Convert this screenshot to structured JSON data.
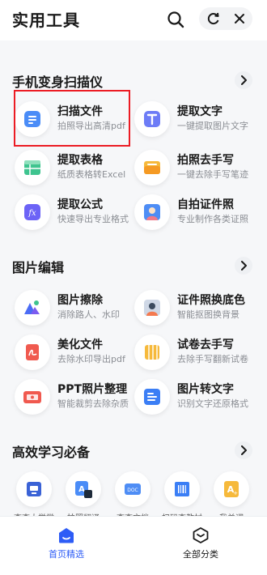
{
  "header": {
    "title": "实用工具",
    "search_icon": "search-icon",
    "capsule_left_icon": "refresh-icon",
    "capsule_right_icon": "close-icon"
  },
  "sections": [
    {
      "title": "手机变身扫描仪",
      "tools": [
        {
          "name": "扫描文件",
          "sub": "拍照导出高清pdf",
          "icon": "scan-file-icon",
          "color": "#4a8cf7"
        },
        {
          "name": "提取文字",
          "sub": "一键提取图片文字",
          "icon": "extract-text-icon",
          "color": "#6d7cf6"
        },
        {
          "name": "提取表格",
          "sub": "纸质表格转Excel",
          "icon": "extract-table-icon",
          "color": "#3ec48f"
        },
        {
          "name": "拍照去手写",
          "sub": "一键去除手写笔迹",
          "icon": "remove-handwriting-icon",
          "color": "#f6b93b"
        },
        {
          "name": "提取公式",
          "sub": "快速导出专业格式",
          "icon": "formula-icon",
          "color": "#6c63f6"
        },
        {
          "name": "自拍证件照",
          "sub": "专业制作各类证照",
          "icon": "id-photo-icon",
          "color": "#4e8df5"
        }
      ]
    },
    {
      "title": "图片编辑",
      "tools": [
        {
          "name": "图片擦除",
          "sub": "消除路人、水印",
          "icon": "image-erase-icon",
          "color": "#4b6cf5"
        },
        {
          "name": "证件照换底色",
          "sub": "智能抠图换背景",
          "icon": "id-bg-change-icon",
          "color": "#f47a50"
        },
        {
          "name": "美化文件",
          "sub": "去除水印导出pdf",
          "icon": "beautify-pdf-icon",
          "color": "#f05a4f"
        },
        {
          "name": "试卷去手写",
          "sub": "去除手写翻新试卷",
          "icon": "exam-clean-icon",
          "color": "#f6b93b"
        },
        {
          "name": "PPT照片整理",
          "sub": "智能裁剪去除杂质",
          "icon": "ppt-photo-icon",
          "color": "#f0594f"
        },
        {
          "name": "图片转文字",
          "sub": "识别文字还原格式",
          "icon": "image-to-text-icon",
          "color": "#3b7ef5"
        }
      ]
    },
    {
      "title": "高效学习必备",
      "tools": [
        {
          "name": "查查大学堂",
          "icon": "study-hall-icon",
          "color": "#3a62d6"
        },
        {
          "name": "拍照翻译",
          "icon": "photo-translate-icon",
          "color": "#4a8cf7"
        },
        {
          "name": "查查文档",
          "icon": "doc-icon",
          "color": "#4e8df5"
        },
        {
          "name": "扫码查教材",
          "icon": "barcode-textbook-icon",
          "color": "#3b7ef5"
        },
        {
          "name": "我单词",
          "icon": "words-icon",
          "color": "#f6b93b"
        }
      ]
    }
  ],
  "tabbar": [
    {
      "label": "首页精选",
      "icon": "home-icon",
      "active": true
    },
    {
      "label": "全部分类",
      "icon": "category-icon",
      "active": false
    }
  ],
  "colors": {
    "accent": "#2d5cf6",
    "highlight": "#ec1c24"
  }
}
